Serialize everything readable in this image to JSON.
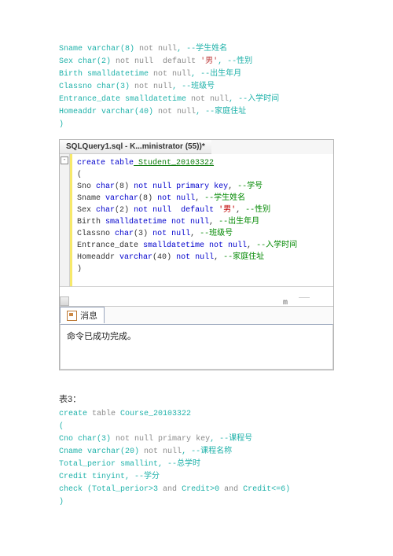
{
  "top_code": {
    "l1": {
      "a": "Sname ",
      "b": "varchar",
      "c": "(8) ",
      "d": "not null",
      "e": ", ",
      "f": "--学生姓名"
    },
    "l2": {
      "a": "Sex ",
      "b": "char",
      "c": "(2) ",
      "d": "not null  default",
      "e": " '男'",
      "f": ", ",
      "g": "--性别"
    },
    "l3": {
      "a": "Birth ",
      "b": "smalldatetime",
      "c": " not null",
      "d": ", ",
      "e": "--出生年月"
    },
    "l4": {
      "a": "Classno ",
      "b": "char",
      "c": "(3) ",
      "d": "not null",
      "e": ", ",
      "f": "--班级号"
    },
    "l5": {
      "a": "Entrance_date ",
      "b": "smalldatetime",
      "c": " not null",
      "d": ", ",
      "e": "--入学时间"
    },
    "l6": {
      "a": "Homeaddr ",
      "b": "varchar",
      "c": "(40) ",
      "d": "not null",
      "e": ", ",
      "f": "--家庭住址"
    },
    "l7": ")"
  },
  "editor": {
    "tab": "SQLQuery1.sql - K...ministrator (55))*",
    "l1": {
      "a": "create",
      "b": " table",
      "c": " Student_20103322"
    },
    "l2": "(",
    "l3": {
      "a": "Sno ",
      "b": "char",
      "c": "(",
      "d": "8",
      "e": ") ",
      "f": "not null primary key",
      "g": ", ",
      "h": "--学号"
    },
    "l4": {
      "a": "Sname ",
      "b": "varchar",
      "c": "(",
      "d": "8",
      "e": ") ",
      "f": "not null",
      "g": ", ",
      "h": "--学生姓名"
    },
    "l5": {
      "a": "Sex ",
      "b": "char",
      "c": "(",
      "d": "2",
      "e": ") ",
      "f": "not null  default",
      "g": " '男'",
      "h": ", ",
      "i": "--性别"
    },
    "l6": {
      "a": "Birth ",
      "b": "smalldatetime",
      "c": " not null",
      "d": ", ",
      "e": "--出生年月"
    },
    "l7": {
      "a": "Classno ",
      "b": "char",
      "c": "(",
      "d": "3",
      "e": ") ",
      "f": "not null",
      "g": ", ",
      "h": "--班级号"
    },
    "l8": {
      "a": "Entrance_date ",
      "b": "smalldatetime",
      "c": " not null",
      "d": ", ",
      "e": "--入学时间"
    },
    "l9": {
      "a": "Homeaddr ",
      "b": "varchar",
      "c": "(",
      "d": "40",
      "e": ") ",
      "f": "not null",
      "g": ", ",
      "h": "--家庭住址"
    },
    "l10": ")",
    "scroll_mark": "m"
  },
  "messages": {
    "tab": "消息",
    "body": "命令已成功完成。"
  },
  "table3_label": "表3：",
  "bottom_code": {
    "l1": {
      "a": "create",
      "b": " table",
      "c": " Course_20103322"
    },
    "l2": "(",
    "l3": {
      "a": "Cno ",
      "b": "char",
      "c": "(3) ",
      "d": "not null primary key",
      "e": ", ",
      "f": "--课程号"
    },
    "l4": {
      "a": "Cname ",
      "b": "varchar",
      "c": "(20) ",
      "d": "not null",
      "e": ", ",
      "f": "--课程名称"
    },
    "l5": {
      "a": "Total_perior ",
      "b": "smallint",
      "c": ", ",
      "d": "--总学时"
    },
    "l6": {
      "a": "Credit ",
      "b": "tinyint",
      "c": ", ",
      "d": "--学分"
    },
    "l7": {
      "a": "check",
      "b": " (Total_perior>3 ",
      "c": "and",
      "d": " Credit>0 ",
      "e": "and",
      "f": " Credit<=6)"
    },
    "l8": ")"
  }
}
